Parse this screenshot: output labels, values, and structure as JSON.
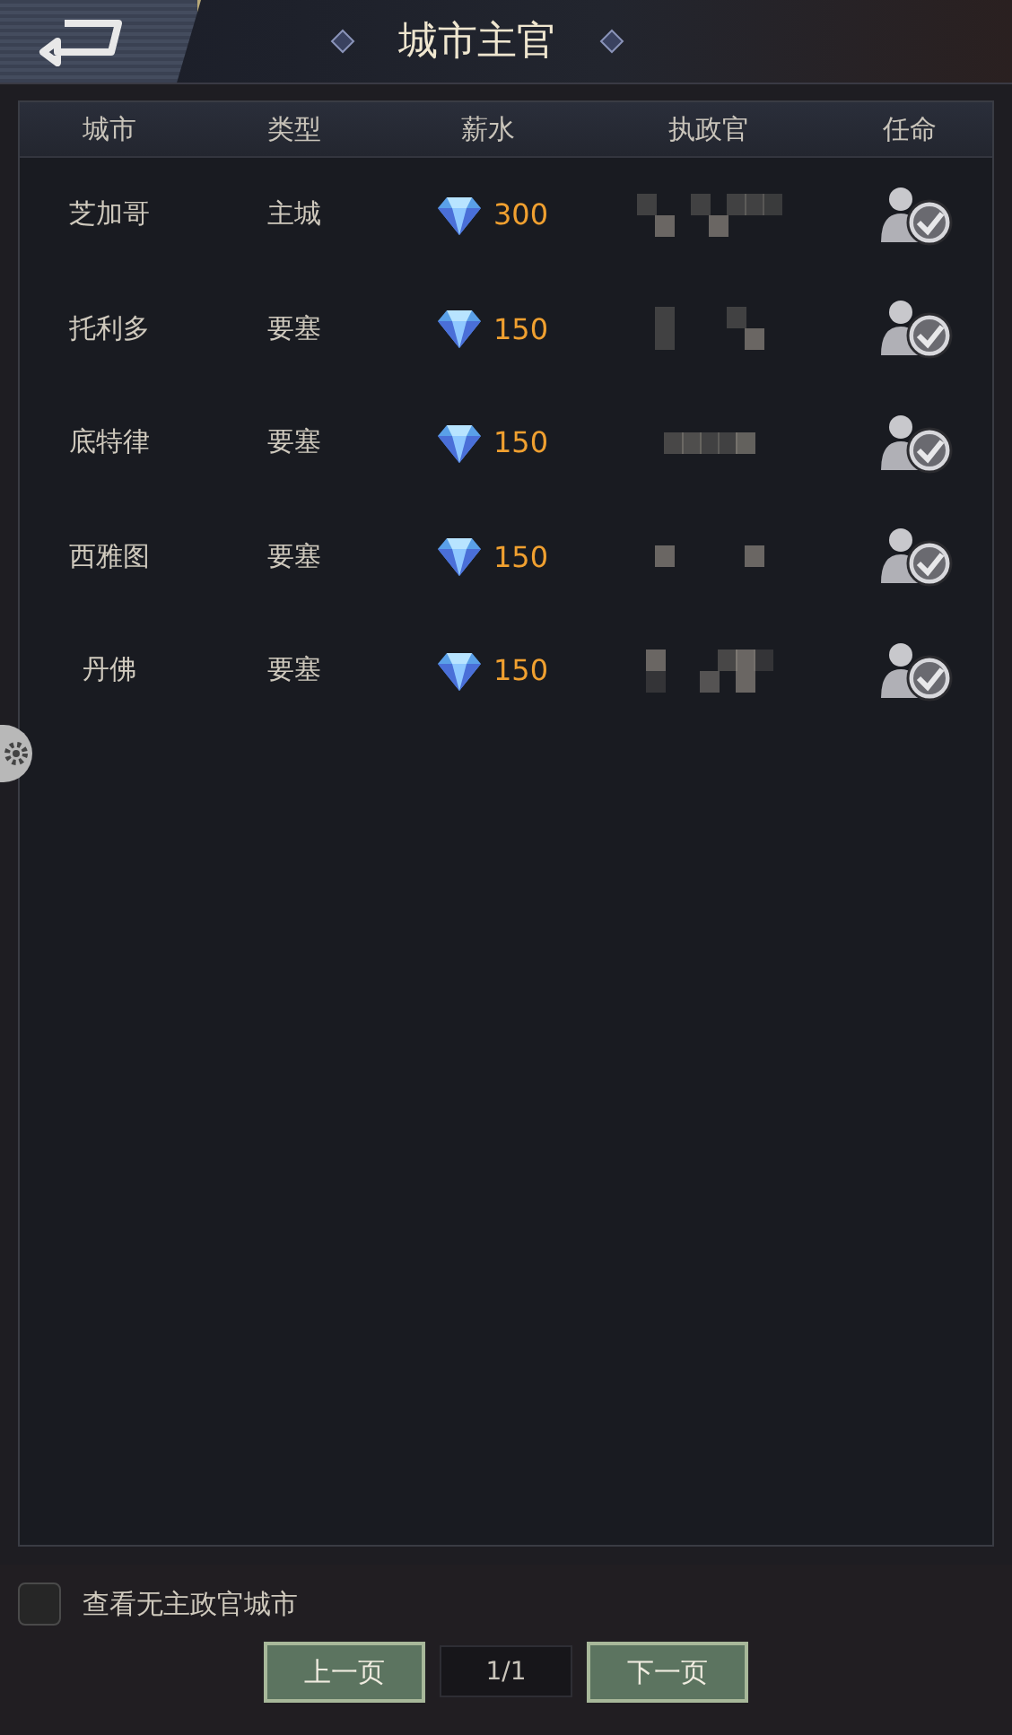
{
  "window": {
    "title": "城市主官"
  },
  "table": {
    "columns": [
      "城市",
      "类型",
      "薪水",
      "执政官",
      "任命"
    ],
    "rows": [
      {
        "city": "芝加哥",
        "type": "主城",
        "salary": "300"
      },
      {
        "city": "托利多",
        "type": "要塞",
        "salary": "150"
      },
      {
        "city": "底特律",
        "type": "要塞",
        "salary": "150"
      },
      {
        "city": "西雅图",
        "type": "要塞",
        "salary": "150"
      },
      {
        "city": "丹佛",
        "type": "要塞",
        "salary": "150"
      }
    ]
  },
  "filter": {
    "label": "查看无主政官城市",
    "checked": false
  },
  "pager": {
    "prev": "上一页",
    "page": "1/1",
    "next": "下一页"
  }
}
